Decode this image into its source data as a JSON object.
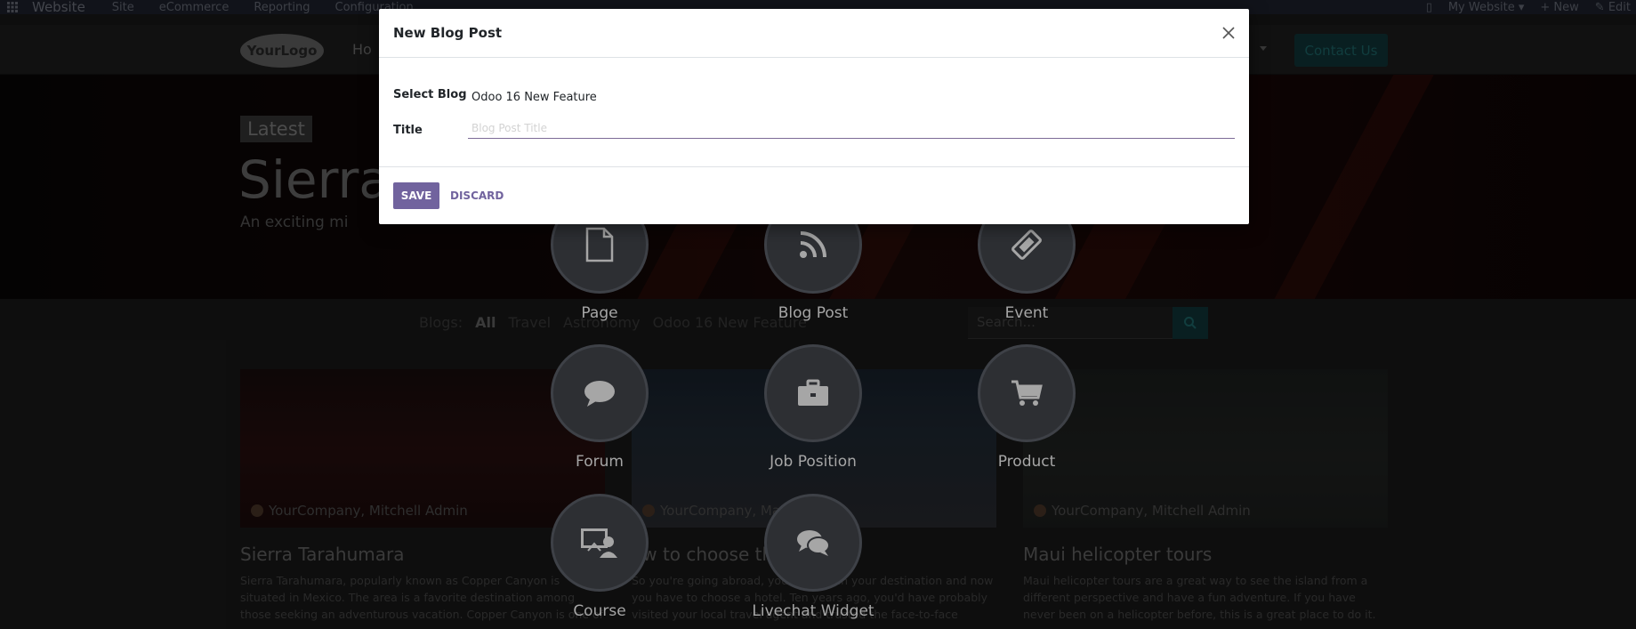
{
  "topbar": {
    "brand": "Website",
    "menu": [
      "Site",
      "eCommerce",
      "Reporting",
      "Configuration"
    ],
    "right": {
      "website": "My Website",
      "new": "New",
      "edit": "Edit"
    }
  },
  "navbar": {
    "logo": "YourLogo",
    "home": "Ho",
    "contact": "Contact Us"
  },
  "hero": {
    "badge": "Latest",
    "title": "Sierra",
    "subtitle": "An exciting mix of r"
  },
  "blog_filter": {
    "label": "Blogs:",
    "items": [
      "All",
      "Travel",
      "Astronomy",
      "Odoo 16 New Feature"
    ],
    "search_placeholder": "Search..."
  },
  "cards": [
    {
      "author": "YourCompany, Mitchell Admin",
      "title": "Sierra Tarahumara",
      "text": "Sierra Tarahumara, popularly known as Copper Canyon is situated in Mexico. The area is a favorite destination among those seeking an adventurous vacation. Copper Canyon is one of the six gorges in the"
    },
    {
      "author": "YourCompany, Ma",
      "title": "ow to choose the",
      "text": "So you're going abroad, you've chosen your destination and now you have to choose a hotel. Ten years ago, you'd have probably visited your local travel agent and trusted the face-to-face advice you we..."
    },
    {
      "author": "YourCompany, Mitchell Admin",
      "title": "Maui helicopter tours",
      "text": "Maui helicopter tours are a great way to see the island from a different perspective and have a fun adventure. If you have never been on a helicopter before, this is a great place to do it. You will s..."
    }
  ],
  "new_content": {
    "items": [
      {
        "label": "Page",
        "icon": "file-icon"
      },
      {
        "label": "Blog Post",
        "icon": "rss-icon"
      },
      {
        "label": "Event",
        "icon": "ticket-icon"
      },
      {
        "label": "Forum",
        "icon": "chat-bubble-icon"
      },
      {
        "label": "Job Position",
        "icon": "briefcase-icon"
      },
      {
        "label": "Product",
        "icon": "shopping-cart-icon"
      },
      {
        "label": "Course",
        "icon": "course-icon"
      },
      {
        "label": "Livechat Widget",
        "icon": "chat-bubbles-icon"
      }
    ]
  },
  "modal": {
    "title": "New Blog Post",
    "select_blog_label": "Select Blog",
    "select_blog_value": "Odoo 16 New Feature",
    "title_label": "Title",
    "title_placeholder": "Blog Post Title",
    "title_value": "",
    "save_label": "SAVE",
    "discard_label": "DISCARD"
  },
  "colors": {
    "primary": "#71639e",
    "accent_teal": "#123a3d"
  }
}
